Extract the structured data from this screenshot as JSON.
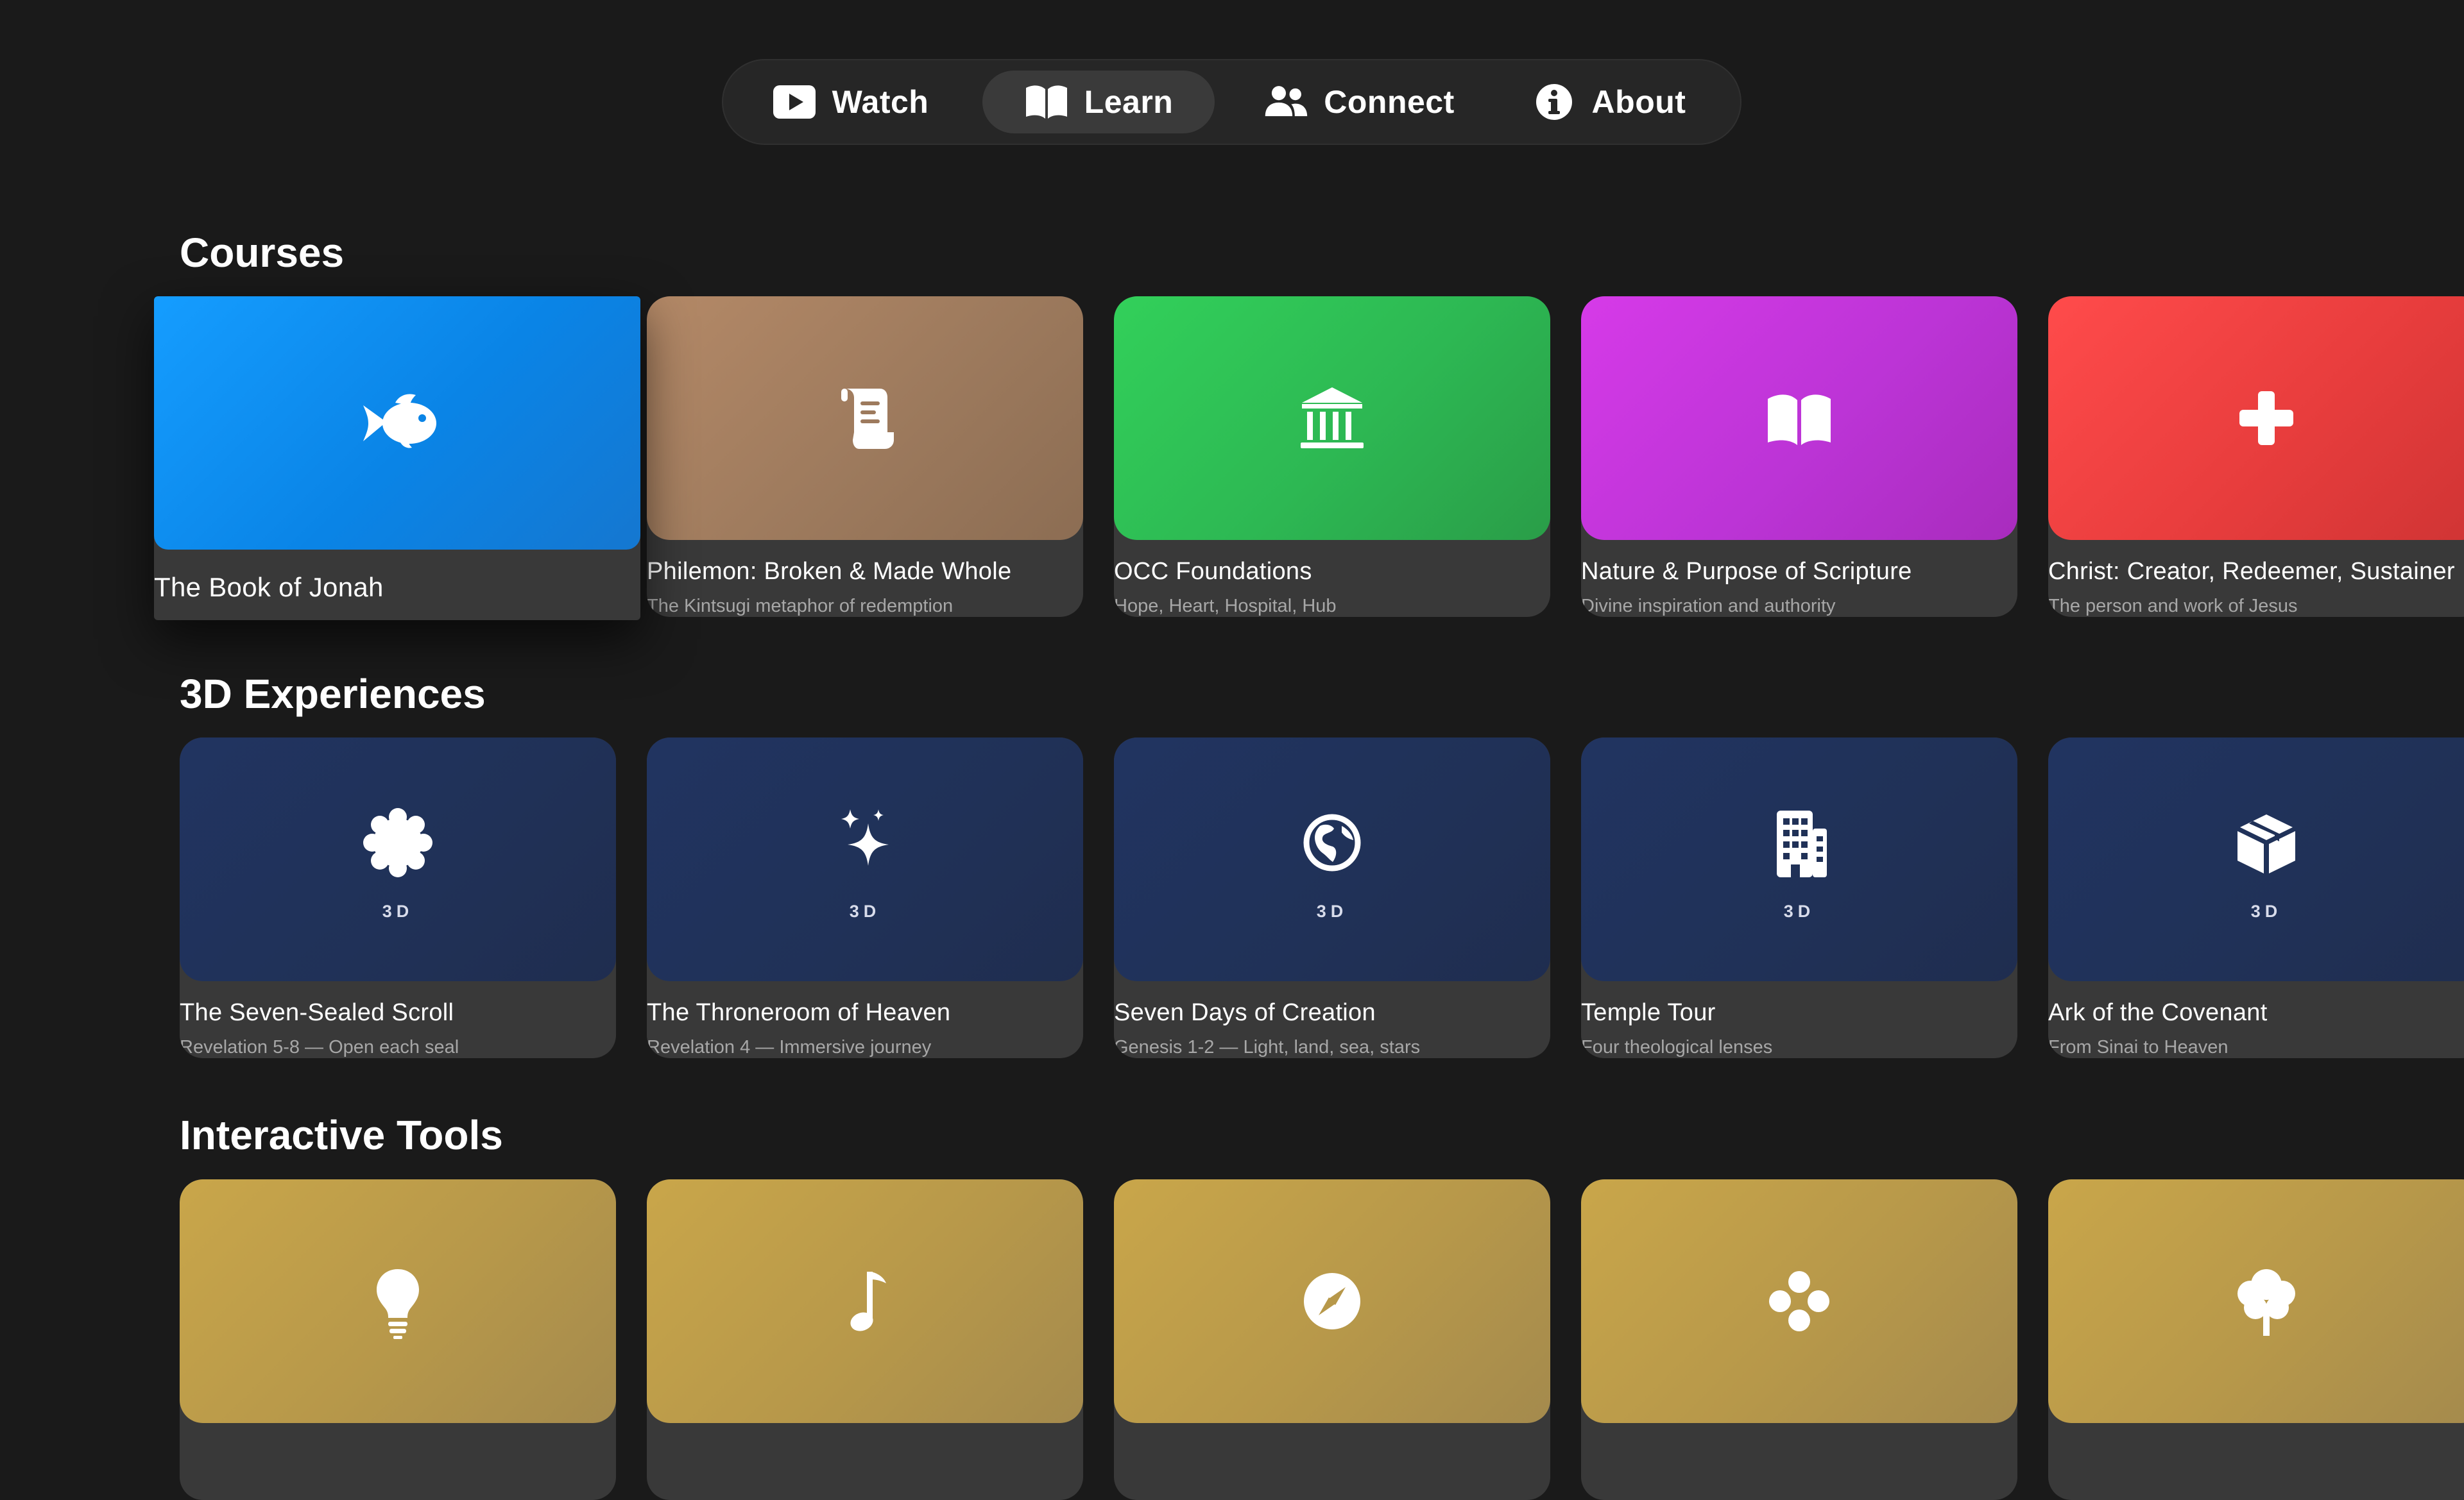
{
  "nav": {
    "items": [
      {
        "id": "watch",
        "label": "Watch",
        "icon": "play-icon"
      },
      {
        "id": "learn",
        "label": "Learn",
        "icon": "book-icon",
        "selected": true
      },
      {
        "id": "connect",
        "label": "Connect",
        "icon": "people-icon"
      },
      {
        "id": "about",
        "label": "About",
        "icon": "info-icon"
      }
    ]
  },
  "sections": {
    "courses": {
      "title": "Courses",
      "cards": [
        {
          "title": "The Book of Jonah",
          "subtitle": "",
          "icon": "fish-icon",
          "color": "#0A84FF",
          "focused": true
        },
        {
          "title": "Philemon: Broken & Made Whole",
          "subtitle": "The Kintsugi metaphor of redemption",
          "icon": "scroll-icon",
          "color": "#A2805F"
        },
        {
          "title": "OCC Foundations",
          "subtitle": "Hope, Heart, Hospital, Hub",
          "icon": "building-columns-icon",
          "color": "#30C552"
        },
        {
          "title": "Nature & Purpose of Scripture",
          "subtitle": "Divine inspiration and authority",
          "icon": "book-open-icon",
          "color": "#C436DF"
        },
        {
          "title": "Christ: Creator, Redeemer, Sustainer",
          "subtitle": "The person and work of Jesus",
          "icon": "cross-icon",
          "color": "#F04343"
        }
      ]
    },
    "experiences": {
      "title": "3D Experiences",
      "cards": [
        {
          "title": "The Seven-Sealed Scroll",
          "subtitle": "Revelation 5-8 — Open each seal",
          "icon": "seal-icon",
          "badge": "3D"
        },
        {
          "title": "The Throneroom of Heaven",
          "subtitle": "Revelation 4 — Immersive journey",
          "icon": "sparkles-icon",
          "badge": "3D"
        },
        {
          "title": "Seven Days of Creation",
          "subtitle": "Genesis 1-2 — Light, land, sea, stars",
          "icon": "globe-icon",
          "badge": "3D"
        },
        {
          "title": "Temple Tour",
          "subtitle": "Four theological lenses",
          "icon": "building-icon",
          "badge": "3D"
        },
        {
          "title": "Ark of the Covenant",
          "subtitle": "From Sinai to Heaven",
          "icon": "cube-icon",
          "badge": "3D"
        }
      ]
    },
    "tools": {
      "title": "Interactive Tools",
      "cards": [
        {
          "icon": "lightbulb-icon"
        },
        {
          "icon": "music-note-icon"
        },
        {
          "icon": "compass-icon"
        },
        {
          "icon": "circle-grid-icon"
        },
        {
          "icon": "tree-icon"
        }
      ]
    }
  },
  "colors": {
    "background": "#1A1A1A",
    "card": "#393939",
    "experience_art": "#203157",
    "tool_art": "#B7984A"
  }
}
